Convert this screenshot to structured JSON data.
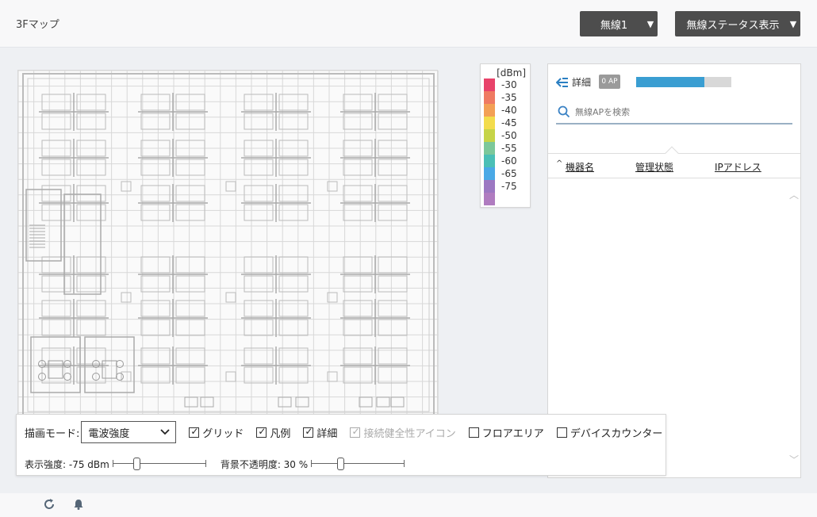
{
  "header": {
    "title": "3Fマップ",
    "wireless_select": "無線1",
    "status_select": "無線ステータス表示"
  },
  "legend": {
    "unit": "[dBm]",
    "levels": [
      {
        "label": "-30",
        "color": "#e8436a"
      },
      {
        "label": "-35",
        "color": "#ef7a62"
      },
      {
        "label": "-40",
        "color": "#f3a055"
      },
      {
        "label": "-45",
        "color": "#f3dc4c"
      },
      {
        "label": "-50",
        "color": "#c6d448"
      },
      {
        "label": "-55",
        "color": "#7cc89a"
      },
      {
        "label": "-60",
        "color": "#4bbfb6"
      },
      {
        "label": "-65",
        "color": "#4aa9e6"
      },
      {
        "label": "-75",
        "color": "#9c78c2"
      },
      {
        "label": "",
        "color": "#b07cc0"
      }
    ]
  },
  "panel": {
    "detail_label": "詳細",
    "ap_count": "0 AP",
    "progress": 0.72,
    "search_placeholder": "無線APを検索",
    "columns": {
      "sort_indicator": "^",
      "name": "機器名",
      "state": "管理状態",
      "ip": "IPアドレス"
    }
  },
  "toolbar": {
    "mode_label": "描画モード:",
    "mode_value": "電波強度",
    "checkboxes": {
      "grid": "グリッド",
      "legend": "凡例",
      "detail": "詳細",
      "health": "接続健全性アイコン",
      "floor_area": "フロアエリア",
      "device_counter": "デバイスカウンター"
    },
    "strength_label": "表示強度: -75 dBm",
    "opacity_label": "背景不透明度: 30 %",
    "strength_level": 0.24,
    "opacity_level": 0.3
  }
}
